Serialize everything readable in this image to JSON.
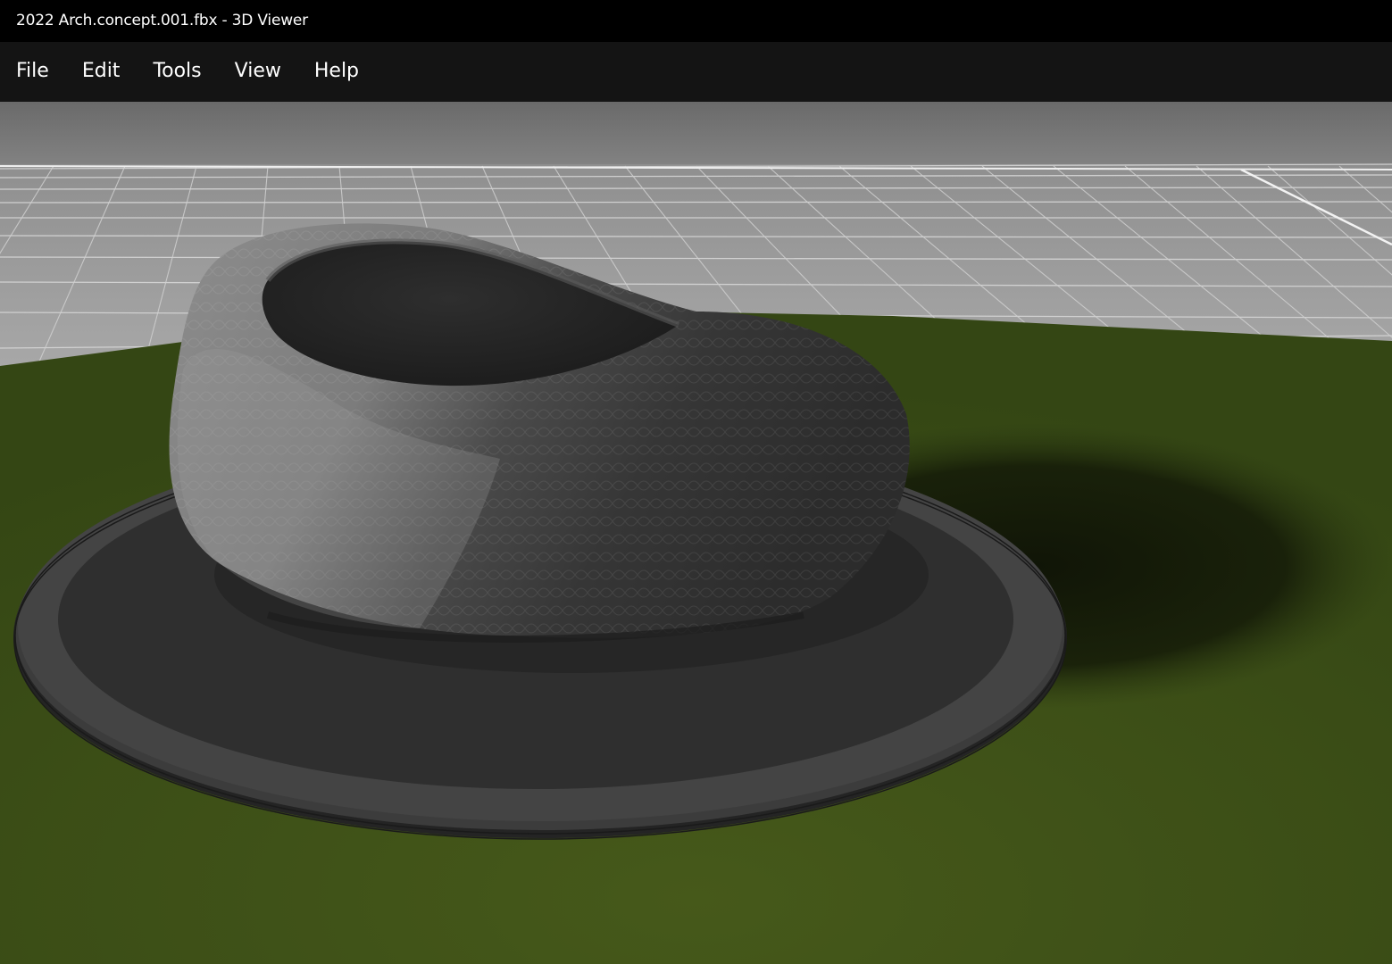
{
  "window": {
    "title": "2022 Arch.concept.001.fbx - 3D Viewer"
  },
  "menu": {
    "items": [
      {
        "id": "file",
        "label": "File"
      },
      {
        "id": "edit",
        "label": "Edit"
      },
      {
        "id": "tools",
        "label": "Tools"
      },
      {
        "id": "view",
        "label": "View"
      },
      {
        "id": "help",
        "label": "Help"
      }
    ]
  },
  "viewport": {
    "scene": "3D model view",
    "colors": {
      "sky": "#6e6e6e",
      "grid_floor": "#9c9c9c",
      "grid_lines": "#d8d8d8",
      "grass": "#3f5317",
      "plaza_outer": "#3a3a3a",
      "plaza_inner": "#2c2c2c",
      "model": "#8c8c8c",
      "shadow": "#151a09"
    }
  }
}
